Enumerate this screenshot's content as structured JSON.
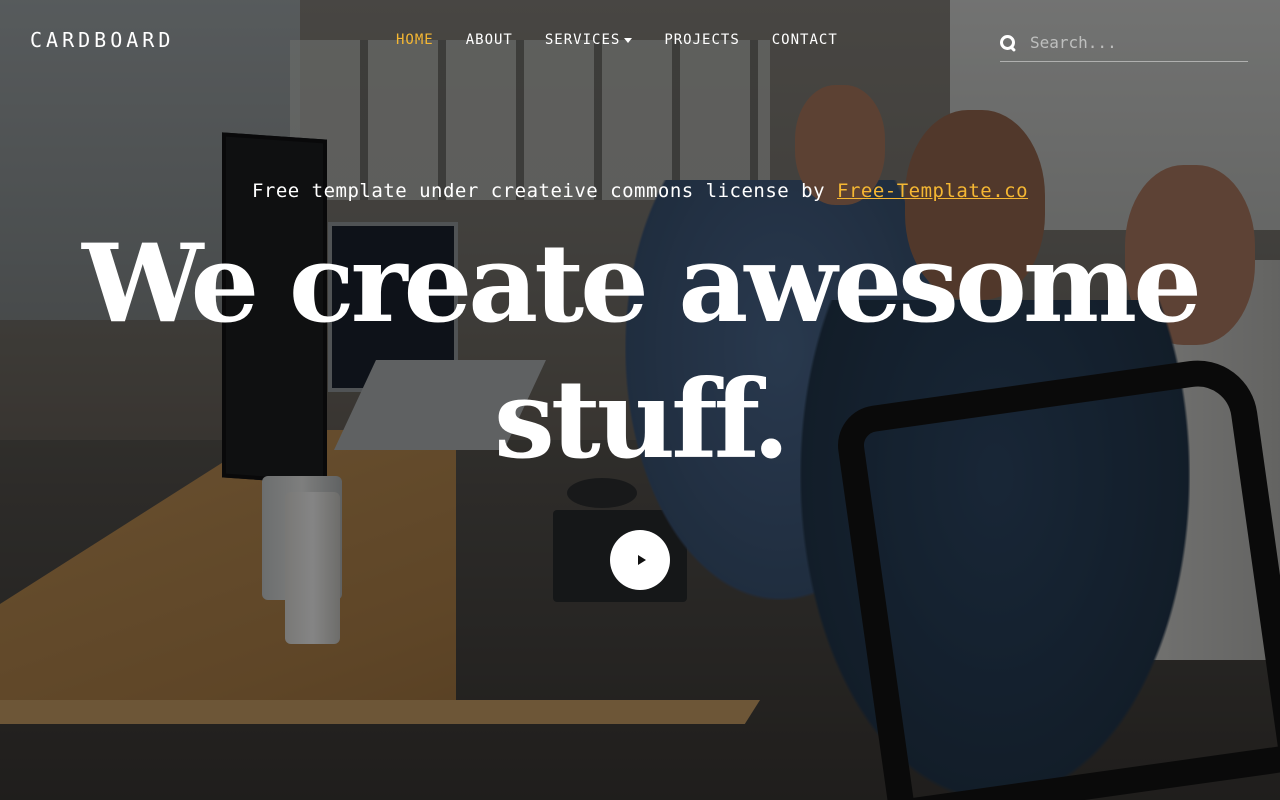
{
  "brand": "CARDBOARD",
  "nav": {
    "items": [
      {
        "label": "HOME",
        "active": true
      },
      {
        "label": "ABOUT",
        "active": false
      },
      {
        "label": "SERVICES",
        "active": false,
        "dropdown": true
      },
      {
        "label": "PROJECTS",
        "active": false
      },
      {
        "label": "CONTACT",
        "active": false
      }
    ]
  },
  "search": {
    "placeholder": "Search...",
    "value": "",
    "icon": "search-icon"
  },
  "hero": {
    "tagline_prefix": "Free template under createive commons license by",
    "tagline_link": "Free-Template.co",
    "headline_line1": "We create awesome",
    "headline_line2": "stuff.",
    "play_icon": "play-icon"
  },
  "colors": {
    "accent": "#f5b733",
    "text": "#ffffff",
    "overlay": "rgba(0,0,0,0.48)"
  }
}
